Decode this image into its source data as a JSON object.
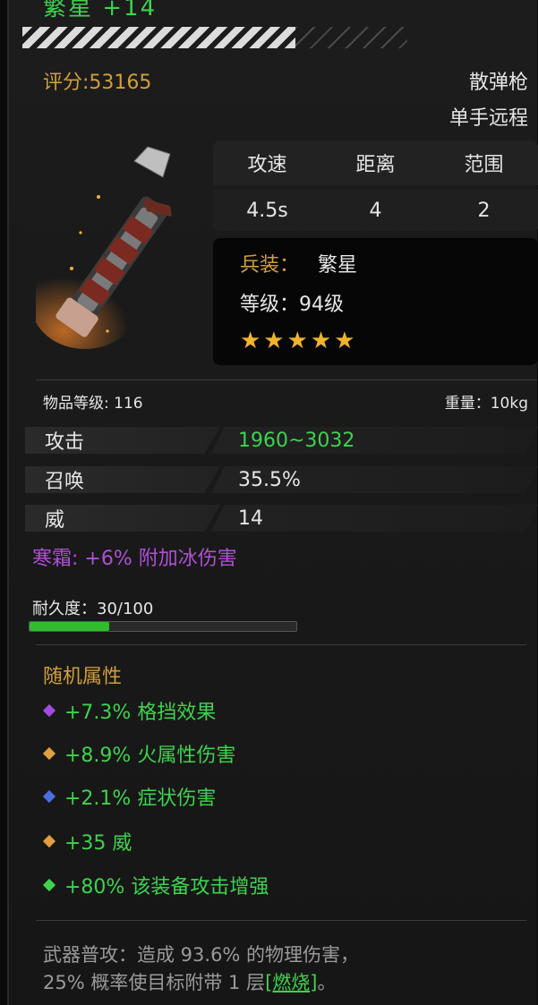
{
  "item": {
    "name": "繁星 +14",
    "score_label": "评分:53165",
    "weapon_type": "散弹枪",
    "weapon_class": "单手远程"
  },
  "stats_table": {
    "headers": [
      "攻速",
      "距离",
      "范围"
    ],
    "values": [
      "4.5s",
      "4",
      "2"
    ]
  },
  "info": {
    "equip_label": "兵装：",
    "equip_value": "繁星",
    "level": "等级：94级",
    "stars": "★★★★★",
    "star_count": 5
  },
  "item_level": "物品等级: 116",
  "weight": "重量：10kg",
  "attributes": [
    {
      "name": "攻击",
      "value": "1960~3032"
    },
    {
      "name": "召唤",
      "value": "35.5%"
    },
    {
      "name": "威",
      "value": "14"
    }
  ],
  "frost": "寒霜: +6% 附加冰伤害",
  "durability": {
    "label": "耐久度：30/100",
    "current": 30,
    "max": 100
  },
  "random_attrs": {
    "title": "随机属性",
    "items": [
      {
        "text": "+7.3% 格挡效果",
        "gem_color": "#a24be0"
      },
      {
        "text": "+8.9% 火属性伤害",
        "gem_color": "#e0a040"
      },
      {
        "text": "+2.1% 症状伤害",
        "gem_color": "#4a6ee0"
      },
      {
        "text": "+35 威",
        "gem_color": "#e0a040"
      },
      {
        "text": "+80% 该装备攻击增强",
        "gem_color": "#3fd24f"
      }
    ]
  },
  "description": {
    "line1": "武器普攻：造成 93.6% 的物理伤害，",
    "line2_prefix": "25% 概率使目标附带 1 层",
    "line2_link": "[燃烧]",
    "line2_suffix": "。"
  },
  "colors": {
    "title_green": "#3fd24f",
    "gold": "#d19f3b",
    "frost_purple": "#b04fd6"
  }
}
